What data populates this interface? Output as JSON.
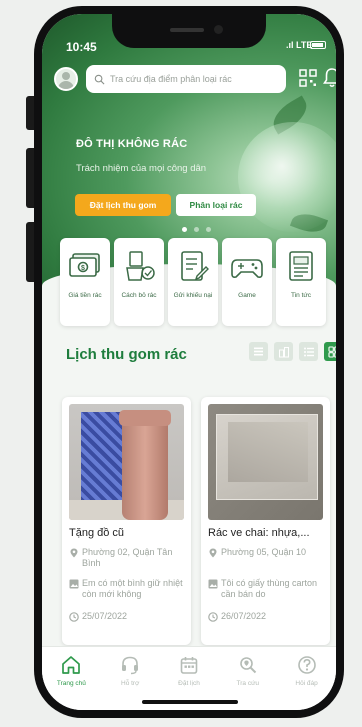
{
  "status": {
    "time": "10:45",
    "network": "LTE"
  },
  "search": {
    "placeholder": "Tra cứu địa điểm phân loại rác"
  },
  "hero": {
    "title": "ĐÔ THỊ KHÔNG RÁC",
    "subtitle": "Trách nhiệm của mọi công dân",
    "primary_button": "Đặt lịch thu gom",
    "secondary_button": "Phân loại rác",
    "carousel": {
      "total": 3,
      "active_index": 0
    }
  },
  "services": [
    {
      "label": "Giá tiền rác",
      "icon": "money-icon"
    },
    {
      "label": "Cách bỏ rác",
      "icon": "recycle-bin-icon"
    },
    {
      "label": "Gửi khiếu nại",
      "icon": "complaint-icon"
    },
    {
      "label": "Game",
      "icon": "gamepad-icon"
    },
    {
      "label": "Tin tức",
      "icon": "news-icon"
    }
  ],
  "section": {
    "title": "Lịch thu gom rác",
    "view_modes": [
      "list-view-icon",
      "building-view-icon",
      "detail-list-view-icon",
      "grid-view-icon"
    ],
    "active_view": "grid-view-icon"
  },
  "cards": [
    {
      "title": "Tặng đồ cũ",
      "location": "Phường 02, Quận Tân Bình",
      "description": "Em có một bình giữ nhiệt còn mới không",
      "date": "25/07/2022"
    },
    {
      "title": "Rác ve chai: nhựa,...",
      "location": "Phường 05, Quận 10",
      "description": "Tôi có giấy thùng carton cần bán do",
      "date": "26/07/2022"
    }
  ],
  "tabbar": [
    {
      "label": "Trang chủ",
      "icon": "home-icon",
      "active": true
    },
    {
      "label": "Hỗ trợ",
      "icon": "support-icon",
      "active": false
    },
    {
      "label": "Đặt lịch",
      "icon": "calendar-icon",
      "active": false
    },
    {
      "label": "Tra cứu",
      "icon": "search-map-icon",
      "active": false
    },
    {
      "label": "Hỏi đáp",
      "icon": "help-icon",
      "active": false
    }
  ],
  "colors": {
    "brand_green": "#2f9a4c",
    "accent_orange": "#f4a81c",
    "title_green": "#1e7d3d"
  }
}
